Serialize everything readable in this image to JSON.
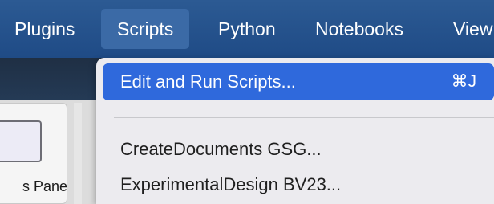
{
  "menubar": {
    "items": [
      "Plugins",
      "Scripts",
      "Python",
      "Notebooks",
      "View"
    ]
  },
  "app": {
    "pane_label": "s Pane"
  },
  "dropdown": {
    "items": [
      {
        "label": "Edit and Run Scripts...",
        "shortcut": "⌘J"
      },
      {
        "label": "CreateDocuments GSG..."
      },
      {
        "label": "ExperimentalDesign BV23..."
      }
    ]
  },
  "colors": {
    "menubar_bg": "#2c5a93",
    "highlight": "#2f69dc",
    "menu_bg": "#ecebef"
  }
}
